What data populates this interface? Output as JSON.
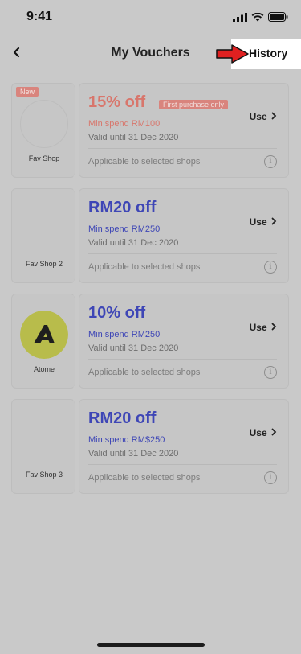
{
  "status_bar": {
    "time": "9:41"
  },
  "header": {
    "title": "My Vouchers",
    "history_label": "History"
  },
  "colors": {
    "accent_red": "#d8766c",
    "accent_blue": "#3e46b6",
    "atome_logo": "#b8bc4b"
  },
  "vouchers": [
    {
      "badge": "New",
      "shop_name": "Fav Shop",
      "title": "15% off",
      "tag": "First purchase only",
      "min_spend": "Min spend RM100",
      "valid": "Valid until 31 Dec 2020",
      "applicable": "Applicable to selected shops",
      "use_label": "Use"
    },
    {
      "shop_name": "Fav Shop 2",
      "title": "RM20 off",
      "min_spend": "Min spend RM250",
      "valid": "Valid until 31 Dec 2020",
      "applicable": "Applicable to selected shops",
      "use_label": "Use"
    },
    {
      "shop_name": "Atome",
      "title": "10% off",
      "min_spend": "Min spend RM250",
      "valid": "Valid until 31 Dec 2020",
      "applicable": "Applicable to selected shops",
      "use_label": "Use"
    },
    {
      "shop_name": "Fav Shop 3",
      "title": "RM20 off",
      "min_spend": "Min spend RM$250",
      "valid": "Valid until 31 Dec 2020",
      "applicable": "Applicable to selected shops",
      "use_label": "Use"
    }
  ]
}
